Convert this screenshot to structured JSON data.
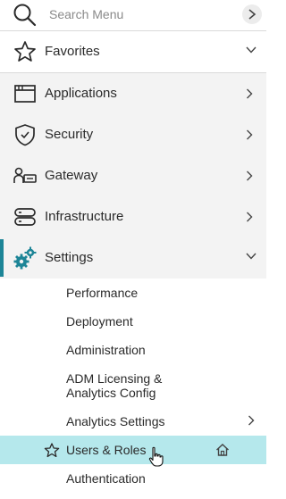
{
  "search": {
    "placeholder": "Search Menu",
    "icon": "search-icon"
  },
  "items": [
    {
      "label": "Favorites",
      "icon": "star-icon"
    },
    {
      "label": "Applications",
      "icon": "applications-icon"
    },
    {
      "label": "Security",
      "icon": "shield-icon"
    },
    {
      "label": "Gateway",
      "icon": "gateway-icon"
    },
    {
      "label": "Infrastructure",
      "icon": "infrastructure-icon"
    },
    {
      "label": "Settings",
      "icon": "gears-icon"
    }
  ],
  "settings_sub": [
    {
      "label": "Performance"
    },
    {
      "label": "Deployment"
    },
    {
      "label": "Administration"
    },
    {
      "label": "ADM Licensing &",
      "label2": "Analytics Config"
    },
    {
      "label": "Analytics Settings"
    },
    {
      "label": "Users & Roles"
    },
    {
      "label": "Authentication"
    }
  ],
  "colors": {
    "accent": "#1d8597",
    "highlight": "#b5e8ec",
    "section_bg": "#f3f3f3"
  }
}
